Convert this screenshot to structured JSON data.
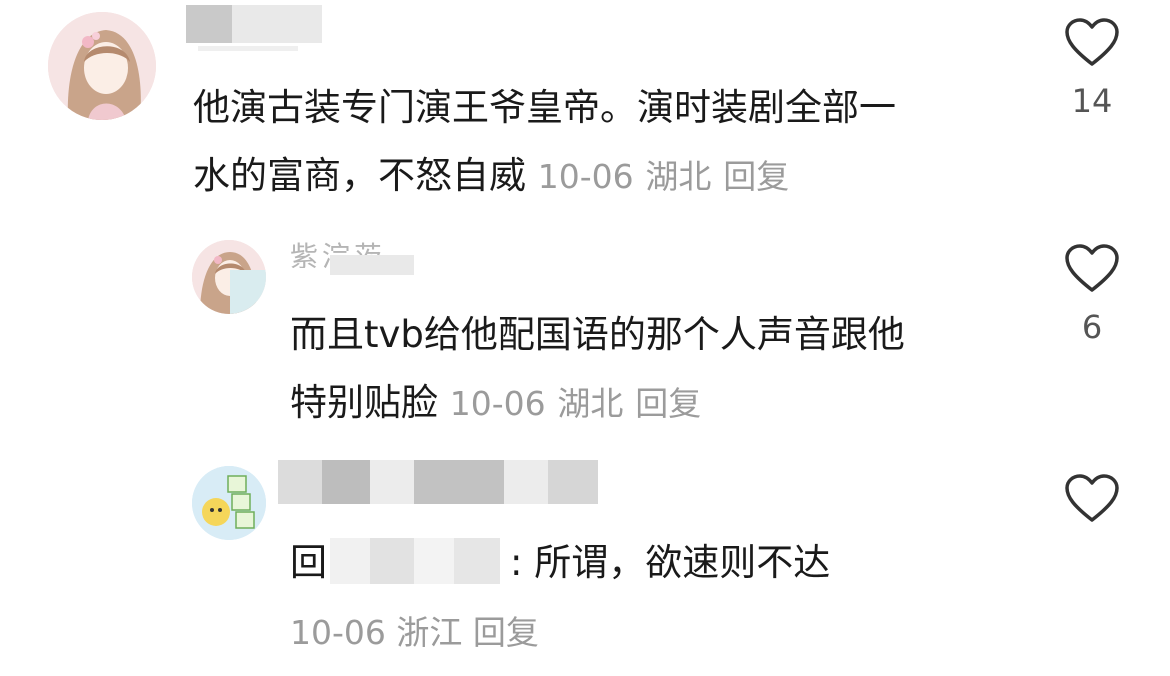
{
  "comments": [
    {
      "text_line1": "他演古装专门演王爷皇帝。演时装剧全部一",
      "text_line2": "水的富商，不怒自威",
      "date": "10-06",
      "location": "湖北",
      "reply_label": "回复",
      "likes": "14"
    },
    {
      "username_partial": "紫淙茨",
      "text_line1": "而且tvb给他配国语的那个人声音跟他",
      "text_line2": "特别贴脸",
      "date": "10-06",
      "location": "湖北",
      "reply_label": "回复",
      "likes": "6"
    },
    {
      "reply_prefix": "回",
      "text": ": 所谓，欲速则不达",
      "date": "10-06",
      "location": "浙江",
      "reply_label": "回复",
      "likes": ""
    }
  ],
  "icons": {
    "like": "heart-outline-icon"
  },
  "colors": {
    "text": "#1a1a1a",
    "meta": "#9b9b9b",
    "icon": "#333333"
  }
}
